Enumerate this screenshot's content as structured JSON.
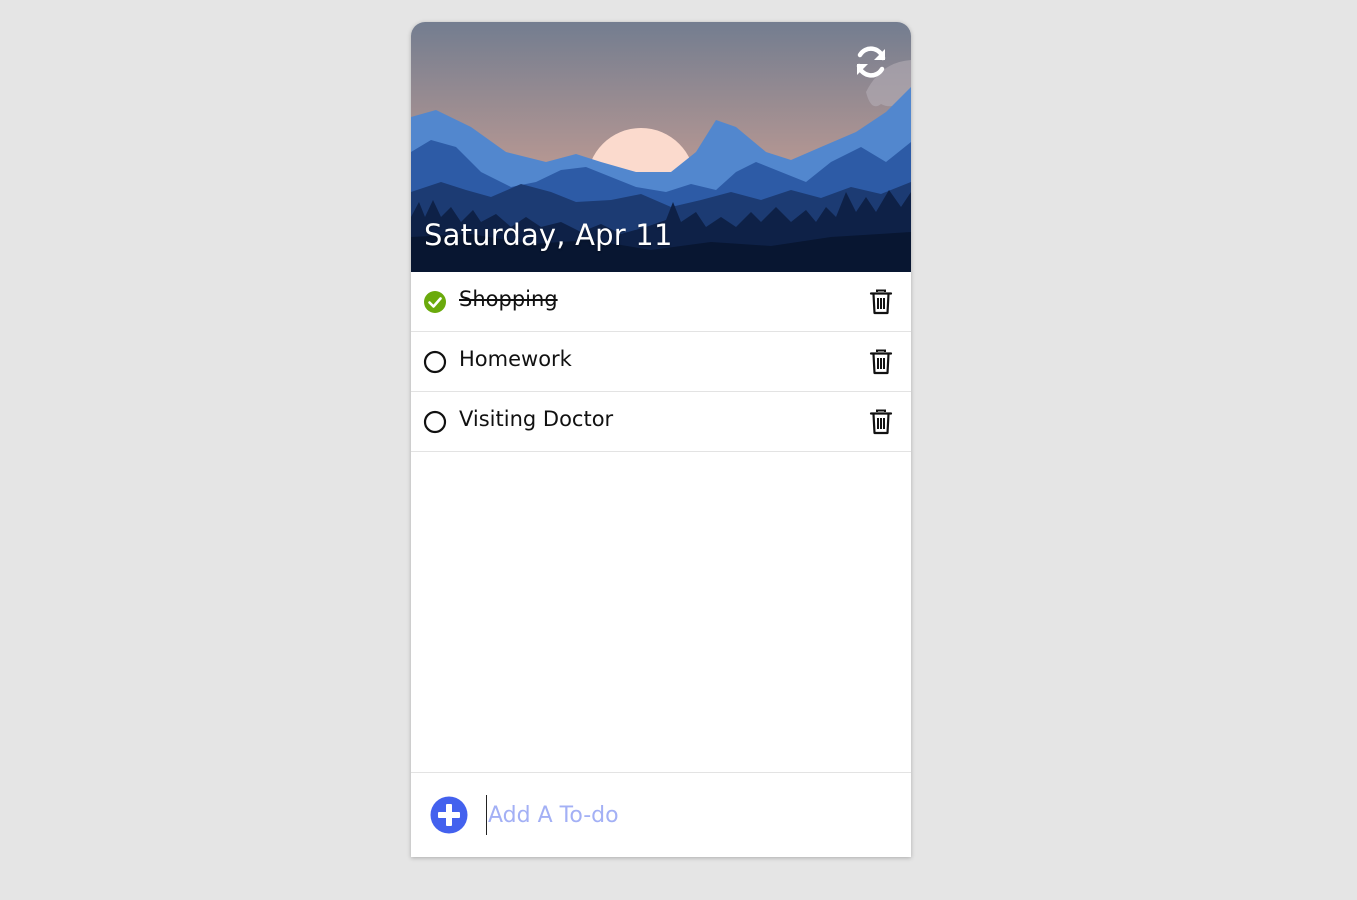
{
  "header": {
    "date": "Saturday, Apr 11",
    "refresh_icon": "refresh-icon"
  },
  "todos": [
    {
      "label": "Shopping",
      "done": true
    },
    {
      "label": "Homework",
      "done": false
    },
    {
      "label": "Visiting Doctor",
      "done": false
    }
  ],
  "footer": {
    "add_icon": "plus-circle-icon",
    "input_placeholder": "Add A To-do",
    "input_value": ""
  },
  "colors": {
    "page_background": "#e5e5e5",
    "check_done": "#6aaa0c",
    "add_button": "#4361ee",
    "placeholder": "#a3b0f5"
  }
}
